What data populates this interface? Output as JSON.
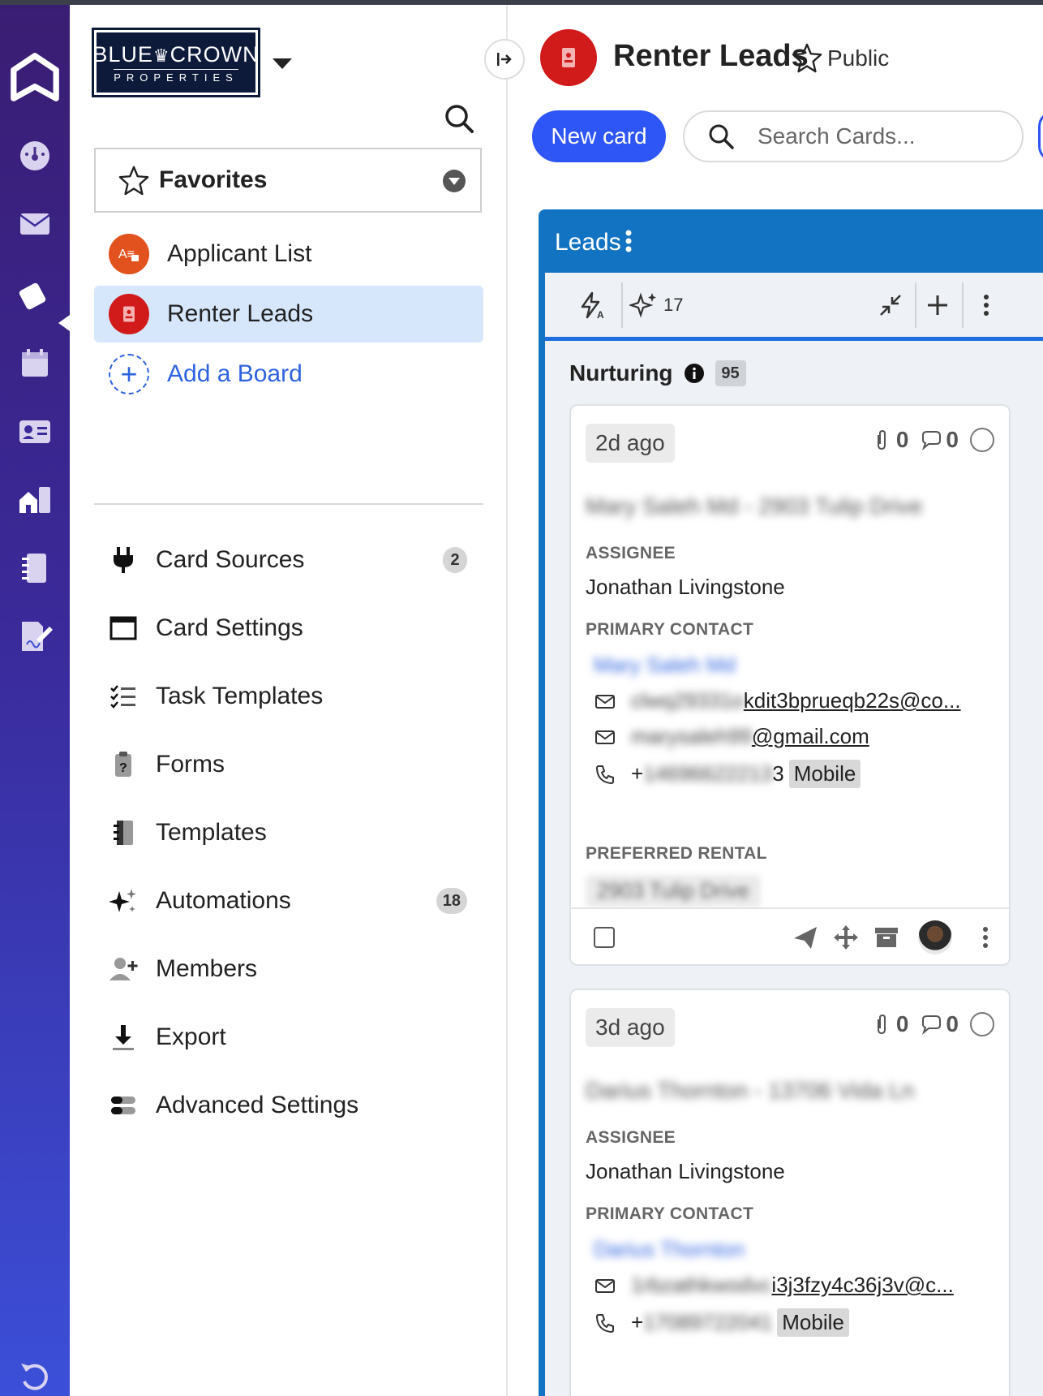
{
  "colors": {
    "rail_top": "#3a1d73",
    "rail_bottom": "#3b4fd8",
    "accent": "#2e55f5",
    "column": "#1173c2",
    "board_red": "#d11a1a",
    "board_orange": "#e2521e",
    "selected_bg": "#d7e7fb"
  },
  "rail": {
    "icons": [
      "home-logo-icon",
      "dashboard-icon",
      "mail-icon",
      "tags-icon",
      "calendar-icon",
      "contact-card-icon",
      "property-icon",
      "notebook-icon",
      "sign-document-icon",
      "undo-icon"
    ]
  },
  "sidebar": {
    "logo": {
      "line1": "BLUE",
      "crown": "♛",
      "line1b": "CROWN",
      "line2": "PROPERTIES"
    },
    "favorites_label": "Favorites",
    "boards": [
      {
        "label": "Applicant List",
        "icon": "applicant-list-icon"
      },
      {
        "label": "Renter Leads",
        "icon": "badge-icon"
      }
    ],
    "add_board": "Add a Board",
    "menu": [
      {
        "label": "Card Sources",
        "icon": "plug-icon",
        "badge": "2"
      },
      {
        "label": "Card Settings",
        "icon": "layout-icon"
      },
      {
        "label": "Task Templates",
        "icon": "checklist-icon"
      },
      {
        "label": "Forms",
        "icon": "clipboard-icon"
      },
      {
        "label": "Templates",
        "icon": "notebook-icon"
      },
      {
        "label": "Automations",
        "icon": "sparkles-icon",
        "badge": "18"
      },
      {
        "label": "Members",
        "icon": "add-member-icon"
      },
      {
        "label": "Export",
        "icon": "download-icon"
      },
      {
        "label": "Advanced Settings",
        "icon": "toggles-icon"
      }
    ]
  },
  "header": {
    "title": "Renter Leads",
    "visibility": "Public",
    "new_card": "New card",
    "search_placeholder": "Search Cards..."
  },
  "column": {
    "title": "Leads",
    "toolbar": {
      "ai_count": "17"
    },
    "stage": {
      "name": "Nurturing",
      "count": "95"
    },
    "cards": [
      {
        "age": "2d ago",
        "attachments": "0",
        "comments": "0",
        "title_redacted": "Mary Saleh Md - 2903 Tulip Drive",
        "assignee_label": "ASSIGNEE",
        "assignee": "Jonathan Livingstone",
        "contact_label": "PRIMARY CONTACT",
        "contact_name_redacted": "Mary Saleh Md",
        "emails": [
          {
            "redacted": "clwq29331o",
            "visible": "kdit3bprueqb22s@co..."
          },
          {
            "redacted": "marysaleh99",
            "visible": "@gmail.com"
          }
        ],
        "phone": {
          "prefix": "+",
          "redacted": "14696622213",
          "visible": "3",
          "type": "Mobile"
        },
        "rental_label": "PREFERRED RENTAL",
        "rental_redacted": "2903 Tulip Drive"
      },
      {
        "age": "3d ago",
        "attachments": "0",
        "comments": "0",
        "title_redacted": "Darius Thornton - 13706 Vida Ln",
        "assignee_label": "ASSIGNEE",
        "assignee": "Jonathan Livingstone",
        "contact_label": "PRIMARY CONTACT",
        "contact_name_redacted": "Darius Thornton",
        "emails": [
          {
            "redacted": "1rbzathkwodvc",
            "visible": "i3j3fzy4c36j3v@c..."
          }
        ],
        "phone": {
          "prefix": "+",
          "redacted": "17089722041",
          "visible": "",
          "type": "Mobile"
        }
      }
    ]
  }
}
